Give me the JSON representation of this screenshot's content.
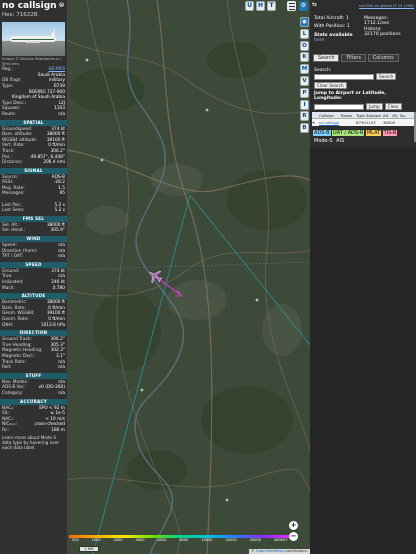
{
  "aircraft": {
    "callsign": "no callsign",
    "hex_label": "Hex:",
    "hex": "71622B",
    "photo_credit": "Image © Nicolas Reddammus / @nicafro",
    "details": [
      {
        "k": "Reg.:",
        "v": "HZ-MF6",
        "link": true
      },
      {
        "k": "",
        "v": "Saudi Arabia"
      },
      {
        "k": "DB flags:",
        "v": "military"
      },
      {
        "k": "Type:",
        "v": "B739"
      },
      {
        "k": "",
        "v": "BOEING 737-900"
      },
      {
        "k": "",
        "v": "Kingdom of Saudi Arabia"
      },
      {
        "k": "Type Desc.:",
        "v": "L2J"
      },
      {
        "k": "Squawk:",
        "v": "1103"
      },
      {
        "k": "Route:",
        "v": "n/a"
      }
    ]
  },
  "sections": [
    {
      "title": "SPATIAL",
      "rows": [
        {
          "k": "Groundspeed:",
          "v": "374 kt"
        },
        {
          "k": "Baro. altitude:",
          "v": "38000 ft"
        },
        {
          "k": "WGS84 altitude:",
          "v": "39100 ft"
        },
        {
          "k": "Vert. Rate:",
          "v": "0 ft/min"
        },
        {
          "k": "Track:",
          "v": "306.2°"
        },
        {
          "k": "Pos.:",
          "v": "49.857°, 6.448°"
        },
        {
          "k": "Distance:",
          "v": "206.4 nmi"
        }
      ]
    },
    {
      "title": "SIGNAL",
      "rows": [
        {
          "k": "Source:",
          "v": "ADS-B"
        },
        {
          "k": "RSSI:",
          "v": "-28.2"
        },
        {
          "k": "Msg. Rate:",
          "v": "1.5"
        },
        {
          "k": "Messages:",
          "v": "95"
        },
        {
          "k": "",
          "v": ""
        },
        {
          "k": "Last Pos.:",
          "v": "5.2 s"
        },
        {
          "k": "Last Seen:",
          "v": "5.2 s"
        }
      ]
    },
    {
      "title": "FMS SEL",
      "rows": [
        {
          "k": "Sel. Alt.:",
          "v": "38000 ft"
        },
        {
          "k": "Sel. Head.:",
          "v": "305.9°"
        }
      ]
    },
    {
      "title": "WIND",
      "rows": [
        {
          "k": "Speed:",
          "v": "n/a"
        },
        {
          "k": "Direction (from):",
          "v": "n/a"
        },
        {
          "k": "TAT / OAT:",
          "v": "n/a"
        }
      ]
    },
    {
      "title": "SPEED",
      "rows": [
        {
          "k": "Ground:",
          "v": "374 kt"
        },
        {
          "k": "True:",
          "v": "n/a"
        },
        {
          "k": "Indicated:",
          "v": "246 kt"
        },
        {
          "k": "Mach:",
          "v": "0.780"
        }
      ]
    },
    {
      "title": "ALTITUDE",
      "rows": [
        {
          "k": "Barometric:",
          "v": "38000 ft"
        },
        {
          "k": "Baro. Rate:",
          "v": "0 ft/min"
        },
        {
          "k": "Geom. WGS84:",
          "v": "39100 ft"
        },
        {
          "k": "Geom. Rate:",
          "v": "0 ft/min"
        },
        {
          "k": "QNH:",
          "v": "1013.6 hPa"
        }
      ]
    },
    {
      "title": "DIRECTION",
      "rows": [
        {
          "k": "Ground Track:",
          "v": "306.2°"
        },
        {
          "k": "True Heading:",
          "v": "305.3°"
        },
        {
          "k": "Magnetic Heading:",
          "v": "302.3°"
        },
        {
          "k": "Magnetic Decl.:",
          "v": "3.1°"
        },
        {
          "k": "Track Rate:",
          "v": "n/a"
        },
        {
          "k": "Roll:",
          "v": "n/a"
        }
      ]
    },
    {
      "title": "STUFF",
      "rows": [
        {
          "k": "Nav. Modes:",
          "v": "n/a"
        },
        {
          "k": "ADS-B Ver.:",
          "v": "v0 (DO-260)"
        },
        {
          "k": "Category:",
          "v": "n/a"
        }
      ]
    },
    {
      "title": "ACCURACY",
      "rows": [
        {
          "k": "NACₚ:",
          "v": "EPU < 92 m"
        },
        {
          "k": "SIL:",
          "v": "≤ 1e-5"
        },
        {
          "k": "NACᵥ:",
          "v": "< 10 m/s"
        },
        {
          "k": "NICᵦₐᵣₒ:",
          "v": "cross-checked"
        },
        {
          "k": "Rc:",
          "v": "186 m"
        }
      ]
    }
  ],
  "note": "Learn more about Mode S data type by hovering over each data label.",
  "map": {
    "top_buttons": [
      "U",
      "H",
      "T"
    ],
    "side_buttons": [
      "",
      "L",
      "O",
      "K",
      "M",
      "V",
      "P",
      "I",
      "R",
      "B"
    ],
    "colorbar_ticks": [
      "500",
      "1000",
      "2000",
      "4000",
      "6000",
      "8000",
      "10000",
      "20000",
      "30000",
      "40000+"
    ],
    "scale": "2 NM",
    "zoom_in": "+",
    "zoom_out": "−",
    "attribution_prefix": "© ",
    "attribution_link": "OpenStreetMap",
    "attribution_suffix": " contributors."
  },
  "right_panel": {
    "top_link": "tar1090 on github (3 14 1756)",
    "stats": {
      "total_label": "Total Aircraft:",
      "total": "1",
      "with_pos_label": "With Position:",
      "with_pos": "1",
      "stats_link": "Stats available",
      "stats_sub": "here",
      "messages_label": "Messages:",
      "messages": "1712.1/sec",
      "history_label": "History:",
      "history": "32170 positions"
    },
    "tabs": [
      "Search",
      "Filters",
      "Columns"
    ],
    "search": {
      "label": "Search:",
      "button": "Search",
      "clear": "Clear Search",
      "jump_label": "Jump to Airport or Latitude, Longitude:",
      "jump_button": "Jump",
      "jump_clear": "Clear"
    },
    "table": {
      "headers": [
        "",
        "Callsign",
        "Route",
        "Type",
        "Squawk",
        "Alt.",
        "(ft)",
        "Sp."
      ],
      "row": [
        "✈",
        "no callsign",
        "",
        "B739",
        "1103",
        "38000",
        "",
        ""
      ]
    },
    "legend": [
      {
        "label": "ADS-B",
        "color": "#7fd0ff"
      },
      {
        "label": "UAT / ADS-R",
        "color": "#a6e37a"
      },
      {
        "label": "MLAT",
        "color": "#ffcc55"
      },
      {
        "label": "TIS-B",
        "color": "#ff9db4"
      },
      {
        "label": "Mode-S",
        "color": ""
      },
      {
        "label": "AIS",
        "color": ""
      }
    ]
  },
  "colors": {
    "accent": "#1f5d6b",
    "track": "#c040c0",
    "aircraft": "#c050c8"
  }
}
